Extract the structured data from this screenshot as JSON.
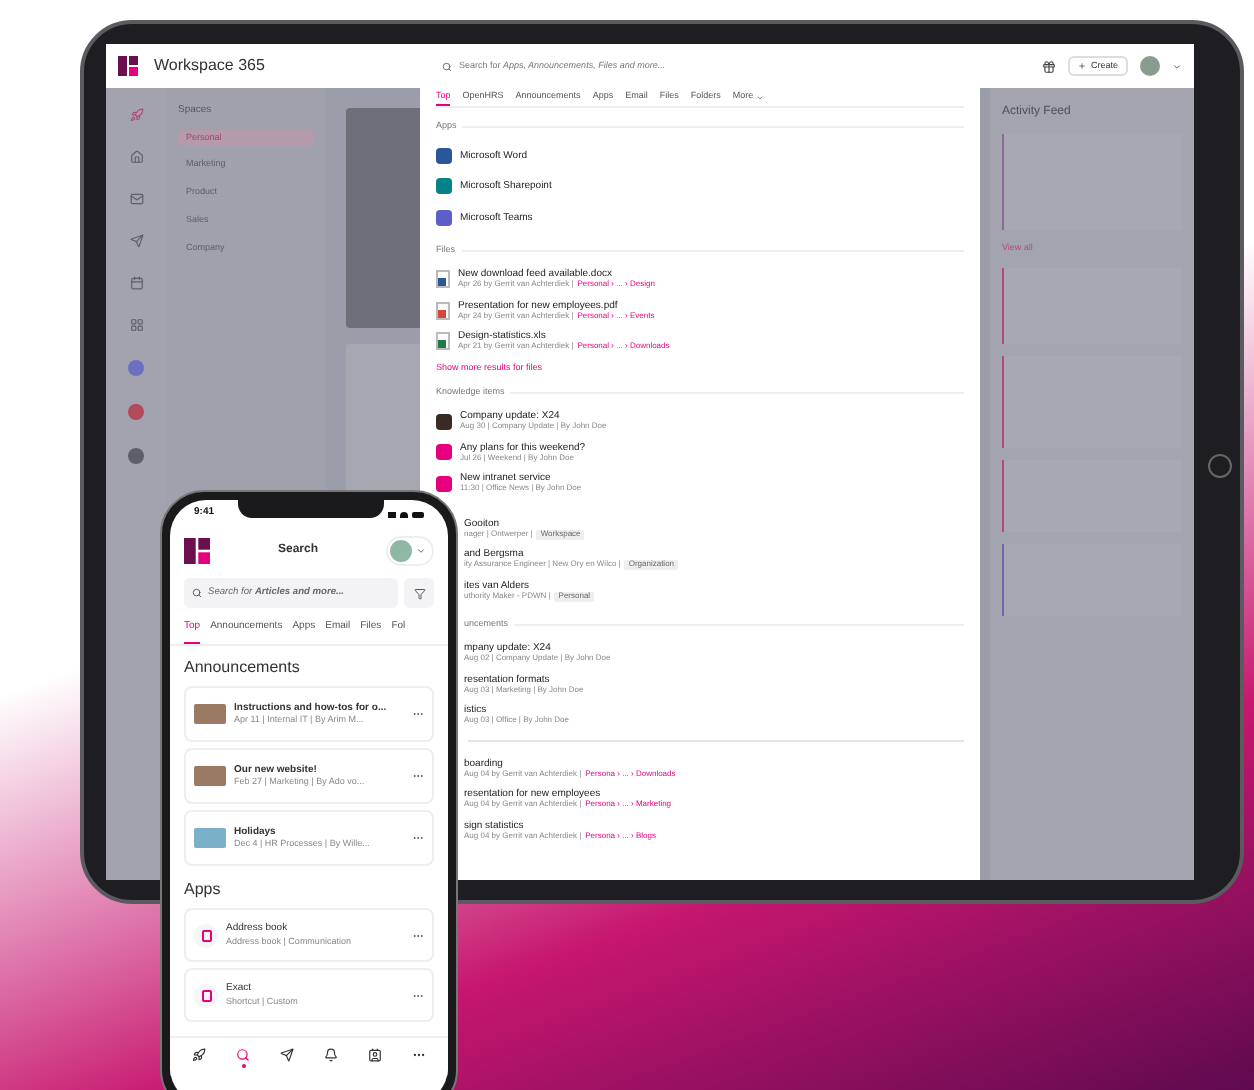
{
  "tablet": {
    "app_name": "Workspace 365",
    "search": {
      "placeholder": "Search for *Apps, Announcements, Files and more...*"
    },
    "create_button": "Create",
    "sidebar": {
      "title": "Spaces",
      "items": [
        {
          "label": "Personal",
          "selected": true
        },
        {
          "label": "Marketing",
          "selected": false
        },
        {
          "label": "Product",
          "selected": false
        },
        {
          "label": "Sales",
          "selected": false
        },
        {
          "label": "Company",
          "selected": false
        }
      ]
    },
    "activity_feed": {
      "title": "Activity Feed",
      "link": "View all"
    },
    "search_results": {
      "tabs": [
        {
          "label": "Top",
          "selected": true
        },
        {
          "label": "OpenHRS",
          "selected": false
        },
        {
          "label": "Announcements",
          "selected": false
        },
        {
          "label": "Apps",
          "selected": false
        },
        {
          "label": "Email",
          "selected": false
        },
        {
          "label": "Files",
          "selected": false
        },
        {
          "label": "Folders",
          "selected": false
        },
        {
          "label": "More",
          "selected": false
        }
      ],
      "sections": [
        {
          "title": "Apps",
          "clipped": false,
          "items": [
            {
              "kind": "app",
              "title": "Microsoft Word",
              "color": "#2b579a"
            },
            {
              "kind": "app",
              "title": "Microsoft Sharepoint",
              "color": "#038387"
            },
            {
              "kind": "app",
              "title": "Microsoft Teams",
              "color": "#5b5fc7"
            }
          ]
        },
        {
          "title": "Files",
          "clipped": false,
          "more_link": "Show more results for files",
          "items": [
            {
              "kind": "file",
              "title": "New download feed available.docx",
              "meta": "Apr 26 by Gerrit van Achterdiek |",
              "path": "Personal › ... › Design",
              "color": "#2b579a"
            },
            {
              "kind": "file",
              "title": "Presentation for new employees.pdf",
              "meta": "Apr 24 by Gerrit van Achterdiek |",
              "path": "Personal › ... › Events",
              "color": "#d9453b"
            },
            {
              "kind": "file",
              "title": "Design-statistics.xls",
              "meta": "Apr 21 by Gerrit van Achterdiek |",
              "path": "Personal › ... › Downloads",
              "color": "#1f7a45"
            }
          ]
        },
        {
          "title": "Knowledge items",
          "clipped": false,
          "items": [
            {
              "kind": "knowledge",
              "title": "Company update: X24",
              "meta": "Aug 30 | Company Update | By John Doe",
              "color": "#3a2a26"
            },
            {
              "kind": "knowledge",
              "title": "Any plans for this weekend?",
              "meta": "Jul 26 | Weekend | By John Doe",
              "color": "#e6007e"
            },
            {
              "kind": "knowledge",
              "title": "New intranet service",
              "meta": "11:30 | Office News | By John Doe",
              "color": "#e6007e"
            }
          ]
        },
        {
          "clipped": true,
          "items": [
            {
              "kind": "person",
              "title": "Gooiton",
              "meta": "nager | Ontwerper |",
              "tag": "Workspace"
            },
            {
              "kind": "person",
              "title": "and Bergsma",
              "meta": "ity Assurance Engineer | New Ory en Wilco |",
              "tag": "Organization"
            },
            {
              "kind": "person",
              "title": "ites van Alders",
              "meta": "uthority Maker - PDWN |",
              "tag": "Personal"
            }
          ]
        },
        {
          "title": "uncements",
          "clipped": true,
          "items": [
            {
              "kind": "text",
              "title": "mpany update: X24",
              "meta": "Aug 02 | Company Update | By John Doe"
            },
            {
              "kind": "text",
              "title": "resentation formats",
              "meta": "Aug 03 | Marketing | By John Doe"
            },
            {
              "kind": "text",
              "title": "istics",
              "meta": "Aug 03 | Office | By John Doe"
            }
          ]
        },
        {
          "clipped": true,
          "divider": true,
          "items": [
            {
              "kind": "text",
              "title": "boarding",
              "meta": "Aug 04 by Gerrit van Achterdiek |",
              "path": "Persona › ... › Downloads"
            },
            {
              "kind": "text",
              "title": "resentation for new employees",
              "meta": "Aug 04 by Gerrit van Achterdiek |",
              "path": "Persona › ... › Marketing"
            },
            {
              "kind": "text",
              "title": "sign statistics",
              "meta": "Aug 04 by Gerrit van Achterdiek |",
              "path": "Persona › ... › Blogs"
            }
          ]
        }
      ]
    }
  },
  "phone": {
    "time": "9:41",
    "title": "Search",
    "search": {
      "placeholder": "Search for **Articles and more...**"
    },
    "tabs": [
      {
        "label": "Top",
        "selected": true
      },
      {
        "label": "Announcements",
        "selected": false
      },
      {
        "label": "Apps",
        "selected": false
      },
      {
        "label": "Email",
        "selected": false
      },
      {
        "label": "Files",
        "selected": false
      },
      {
        "label": "Fol",
        "selected": false
      }
    ],
    "announcements": {
      "title": "Announcements",
      "items": [
        {
          "title": "Instructions and how-tos for o...",
          "meta": "Apr 11 | Internal IT | By Arim M..."
        },
        {
          "title": "Our new website!",
          "meta": "Feb 27 | Marketing | By Ado vo..."
        },
        {
          "title": "Holidays",
          "meta": "Dec 4 | HR Processes | By Wille..."
        }
      ]
    },
    "apps": {
      "title": "Apps",
      "items": [
        {
          "title": "Address book",
          "meta": "Address book | Communication"
        },
        {
          "title": "Exact",
          "meta": "Shortcut | Custom"
        }
      ]
    },
    "nav": [
      {
        "selected": false
      },
      {
        "selected": true
      },
      {
        "selected": false
      },
      {
        "selected": false
      },
      {
        "selected": false
      },
      {
        "selected": false
      }
    ]
  }
}
